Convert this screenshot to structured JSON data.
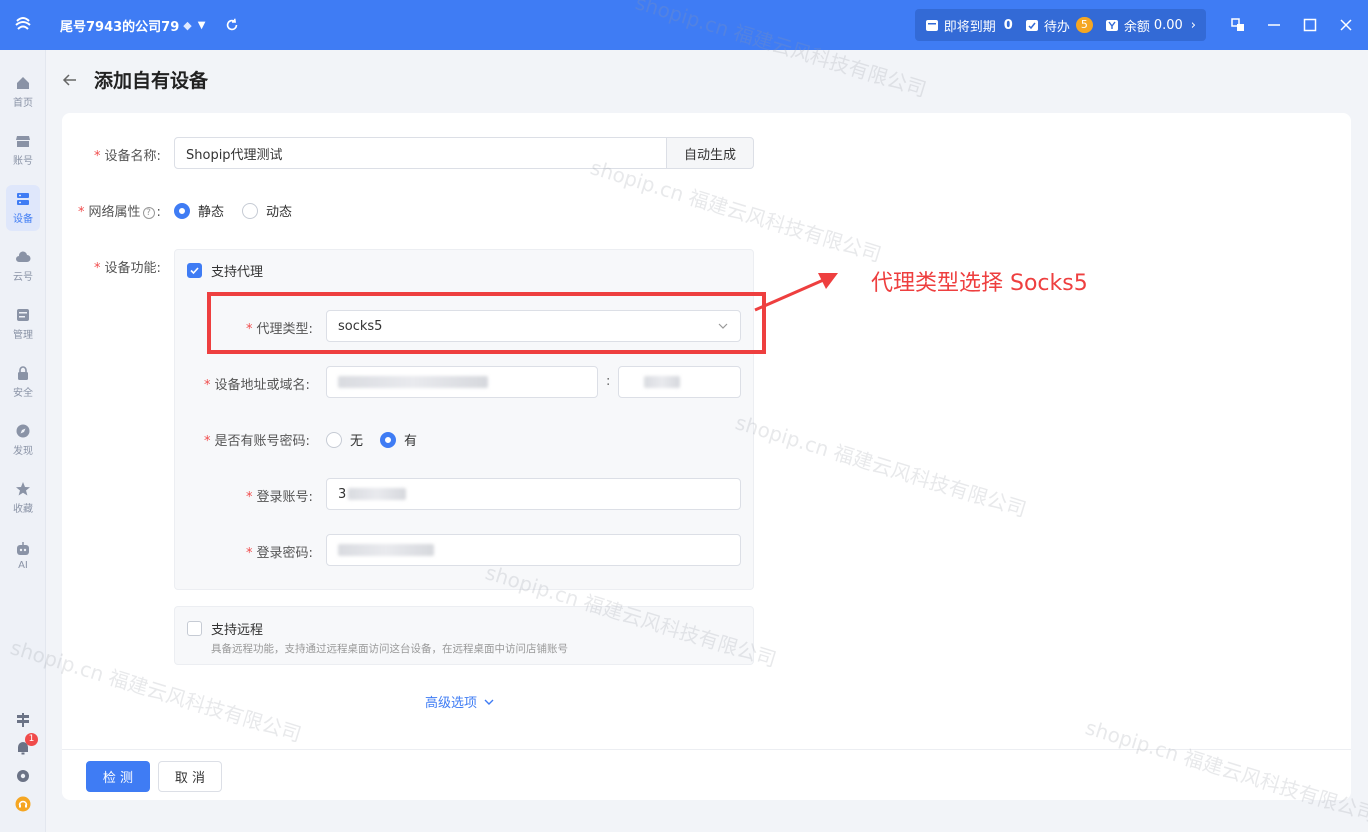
{
  "titlebar": {
    "company": "尾号7943的公司79",
    "expiring_label": "即将到期",
    "expiring_count": "0",
    "todo_label": "待办",
    "todo_count": "5",
    "balance_label": "余额",
    "balance_value": "0.00"
  },
  "sidenav": {
    "items": [
      {
        "label": "首页",
        "icon": "home-icon"
      },
      {
        "label": "账号",
        "icon": "shop-icon"
      },
      {
        "label": "设备",
        "icon": "server-icon"
      },
      {
        "label": "云号",
        "icon": "cloud-icon"
      },
      {
        "label": "管理",
        "icon": "manage-icon"
      },
      {
        "label": "安全",
        "icon": "lock-icon"
      },
      {
        "label": "发现",
        "icon": "compass-icon"
      },
      {
        "label": "收藏",
        "icon": "star-icon"
      },
      {
        "label": "AI",
        "icon": "robot-icon"
      }
    ],
    "notification_count": "1"
  },
  "page": {
    "title": "添加自有设备"
  },
  "form": {
    "device_name_label": "设备名称:",
    "device_name_value": "Shopip代理测试",
    "auto_generate": "自动生成",
    "network_label": "网络属性",
    "network_label_suffix": ":",
    "static_label": "静态",
    "dynamic_label": "动态",
    "function_label": "设备功能:",
    "support_proxy": "支持代理",
    "proxy_type_label": "代理类型:",
    "proxy_type_value": "socks5",
    "address_label": "设备地址或域名:",
    "port_separator": ":",
    "has_auth_label": "是否有账号密码:",
    "no_label": "无",
    "yes_label": "有",
    "login_account_label": "登录账号:",
    "login_account_value": "3",
    "login_password_label": "登录密码:",
    "support_remote": "支持远程",
    "remote_desc": "具备远程功能，支持通过远程桌面访问这台设备，在远程桌面中访问店铺账号",
    "advanced": "高级选项"
  },
  "annotation": {
    "text": "代理类型选择 Socks5",
    "color": "#ee3f3f"
  },
  "footer": {
    "check_button": "检 测",
    "cancel_button": "取 消"
  },
  "watermark": "shopip.cn 福建云风科技有限公司",
  "colors": {
    "primary": "#3f7cf4",
    "danger": "#f04b4b"
  }
}
